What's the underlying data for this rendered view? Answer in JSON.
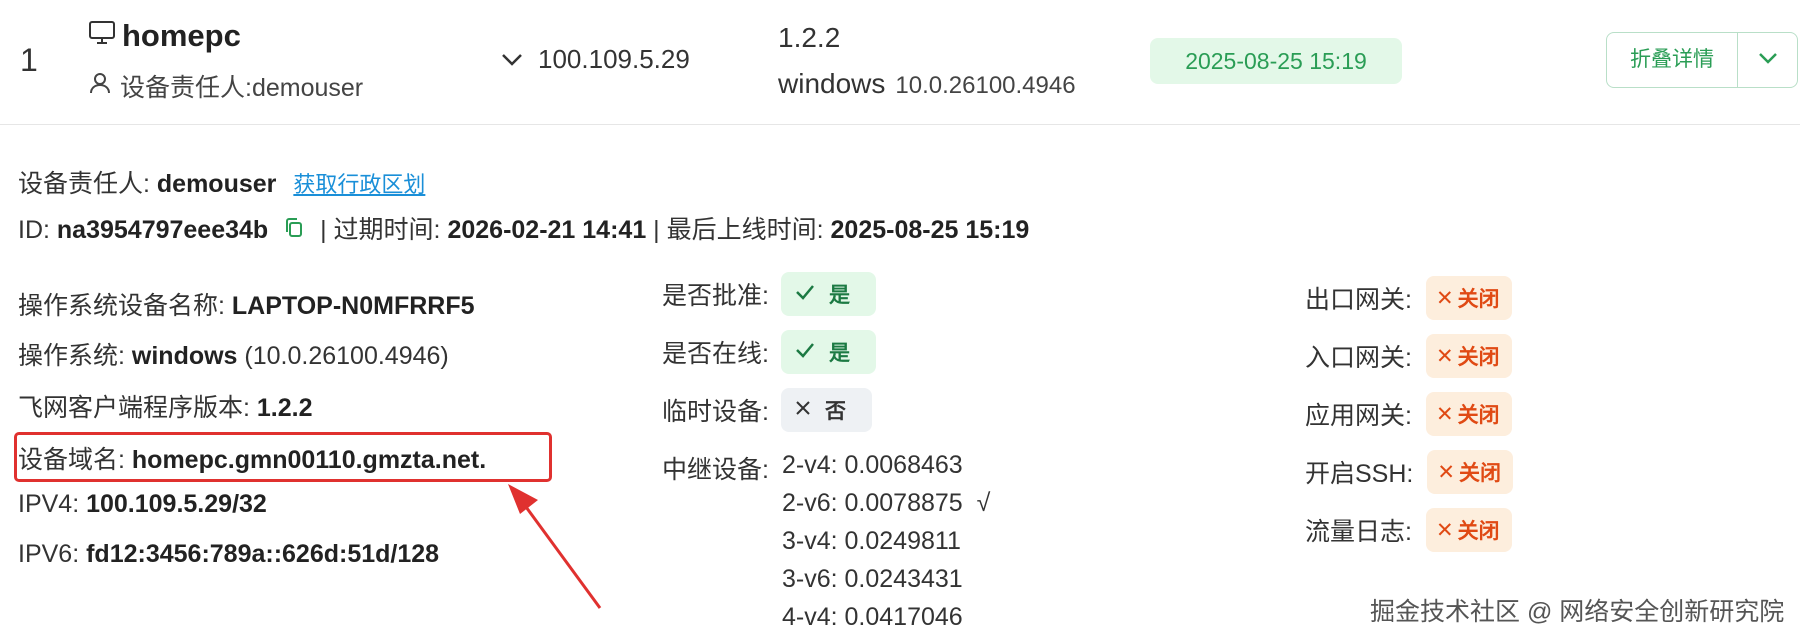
{
  "row": {
    "index": "1",
    "hostname": "homepc",
    "owner_label": "设备责任人:demouser",
    "ip": "100.109.5.29",
    "client_version": "1.2.2",
    "os_name": "windows",
    "os_version": "10.0.26100.4946",
    "last_seen": "2025-08-25 15:19",
    "collapse_label": "折叠详情"
  },
  "detail": {
    "owner_key": "设备责任人: ",
    "owner_val": "demouser",
    "admin_link": "获取行政区划",
    "id_key": "ID: ",
    "id_val": "na3954797eee34b",
    "expire_key": " | 过期时间: ",
    "expire_val": "2026-02-21 14:41",
    "lastonline_key": " | 最后上线时间: ",
    "lastonline_val": "2025-08-25 15:19",
    "left": [
      {
        "key": "操作系统设备名称: ",
        "val": "LAPTOP-N0MFRRF5",
        "extra": ""
      },
      {
        "key": "操作系统: ",
        "val": "windows",
        "extra": " (10.0.26100.4946)"
      },
      {
        "key": "飞网客户端程序版本: ",
        "val": "1.2.2",
        "extra": ""
      },
      {
        "key": "设备域名: ",
        "val": "homepc.gmn00110.gmzta.net.",
        "extra": ""
      },
      {
        "key": "IPV4: ",
        "val": "100.109.5.29/32",
        "extra": ""
      },
      {
        "key": "IPV6: ",
        "val": "fd12:3456:789a::626d:51d/128",
        "extra": ""
      }
    ],
    "approved_key": "是否批准:",
    "approved_val": "是",
    "online_key": "是否在线:",
    "online_val": "是",
    "temp_key": "临时设备:",
    "temp_val": "否",
    "relay_key": "中继设备:",
    "relays": [
      "2-v4: 0.0068463",
      "2-v6: 0.0078875  √",
      "3-v4: 0.0249811",
      "3-v6: 0.0243431",
      "4-v4: 0.0417046"
    ],
    "gateways": [
      {
        "key": "出口网关:",
        "val": "关闭"
      },
      {
        "key": "入口网关:",
        "val": "关闭"
      },
      {
        "key": "应用网关:",
        "val": "关闭"
      },
      {
        "key": "开启SSH:",
        "val": "关闭"
      },
      {
        "key": "流量日志:",
        "val": "关闭"
      }
    ]
  },
  "watermark": "掘金技术社区 @ 网络安全创新研究院",
  "colors": {
    "green": "#2a9d55",
    "orange": "#e04a14",
    "link": "#1a8fd8",
    "red_box": "#e0312f"
  }
}
